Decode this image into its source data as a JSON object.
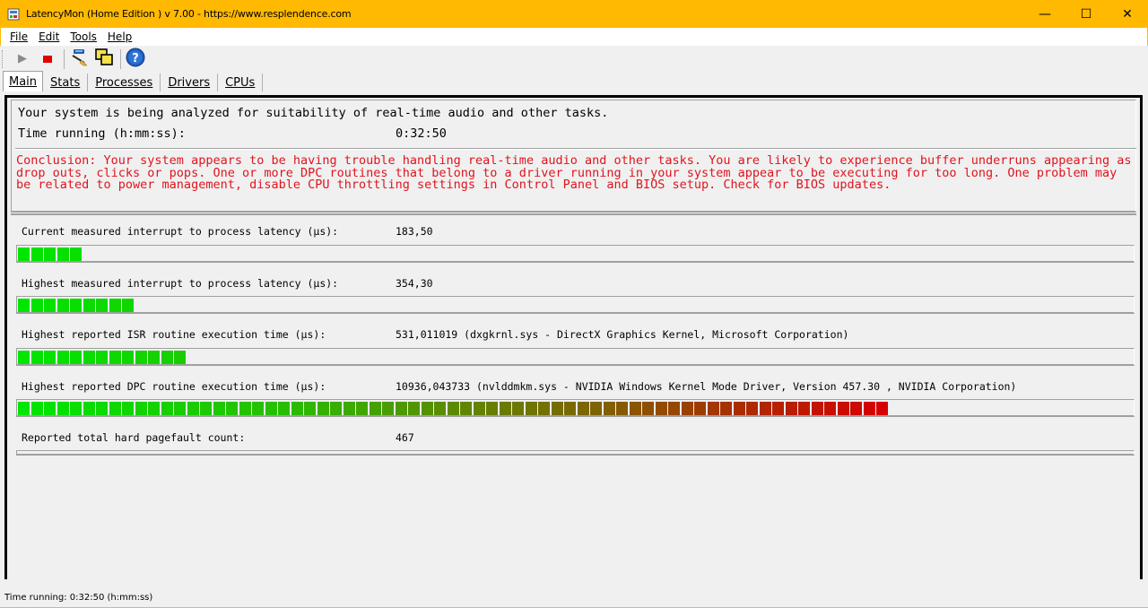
{
  "window": {
    "title": "LatencyMon  (Home Edition )  v 7.00 - https://www.resplendence.com",
    "minimize_glyph": "—",
    "maximize_glyph": "☐",
    "close_glyph": "✕",
    "title_bar_color": "#ffb900"
  },
  "menu": [
    "File",
    "Edit",
    "Tools",
    "Help"
  ],
  "toolbar": {
    "buttons": [
      {
        "name": "play-icon",
        "glyph": "▶",
        "enabled": false
      },
      {
        "name": "stop-icon",
        "glyph": "■",
        "color": "#e00000"
      },
      {
        "name": "broom-icon"
      },
      {
        "name": "windows-icon"
      },
      {
        "name": "help-icon",
        "glyph": "?"
      }
    ]
  },
  "tabs": [
    "Main",
    "Stats",
    "Processes",
    "Drivers",
    "CPUs"
  ],
  "active_tab": "Main",
  "status": {
    "analyzing": "Your system is being analyzed for suitability of real-time audio and other tasks.",
    "time_label": "Time running (h:mm:ss):",
    "time_value": "0:32:50",
    "conclusion_lines": [
      "Conclusion: Your system appears to be having trouble handling real-time audio and other tasks. You are likely to experience buffer underruns appearing as",
      "drop outs, clicks or pops. One or more DPC routines that belong to a driver running in your system appear to be executing for too long. One problem may",
      "be related to power management, disable CPU throttling settings in Control Panel and BIOS setup. Check for BIOS updates."
    ],
    "conclusion_color": "#e0141e"
  },
  "metrics": [
    {
      "label": "Current measured interrupt to process latency (µs):",
      "value": "183,50",
      "segments": 5
    },
    {
      "label": "Highest measured interrupt to process latency (µs):",
      "value": "354,30",
      "segments": 9
    },
    {
      "label": "Highest reported ISR routine execution time (µs):",
      "value": "531,011019  (dxgkrnl.sys - DirectX Graphics Kernel, Microsoft Corporation)",
      "segments": 13
    },
    {
      "label": "Highest reported DPC routine execution time (µs):",
      "value": "10936,043733  (nvlddmkm.sys - NVIDIA Windows Kernel Mode Driver, Version 457.30 , NVIDIA Corporation)",
      "segments": 67
    },
    {
      "label": "Reported total hard pagefault count:",
      "value": "467",
      "segments": 0
    }
  ],
  "statusbar": "Time running: 0:32:50  (h:mm:ss)"
}
